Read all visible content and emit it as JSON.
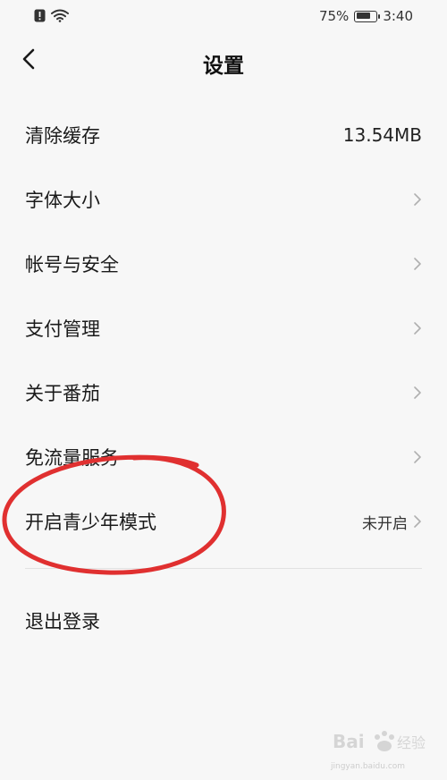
{
  "status_bar": {
    "battery_text": "75%",
    "battery_level": 0.75,
    "time": "3:40",
    "icons": [
      "alert-icon",
      "wifi-icon",
      "battery-icon"
    ]
  },
  "header": {
    "title": "设置",
    "back_icon": "chevron-left-icon"
  },
  "settings": {
    "items": [
      {
        "label": "清除缓存",
        "value": "13.54MB"
      },
      {
        "label": "字体大小"
      },
      {
        "label": "帐号与安全"
      },
      {
        "label": "支付管理"
      },
      {
        "label": "关于番茄"
      },
      {
        "label": "免流量服务"
      },
      {
        "label": "开启青少年模式",
        "value": "未开启"
      }
    ],
    "logout_label": "退出登录"
  },
  "colors": {
    "background": "#f7f7f7",
    "annotation": "#e03030",
    "chevron": "#b0b0b0"
  },
  "watermark": {
    "text": "jingyan.baidu.com"
  }
}
